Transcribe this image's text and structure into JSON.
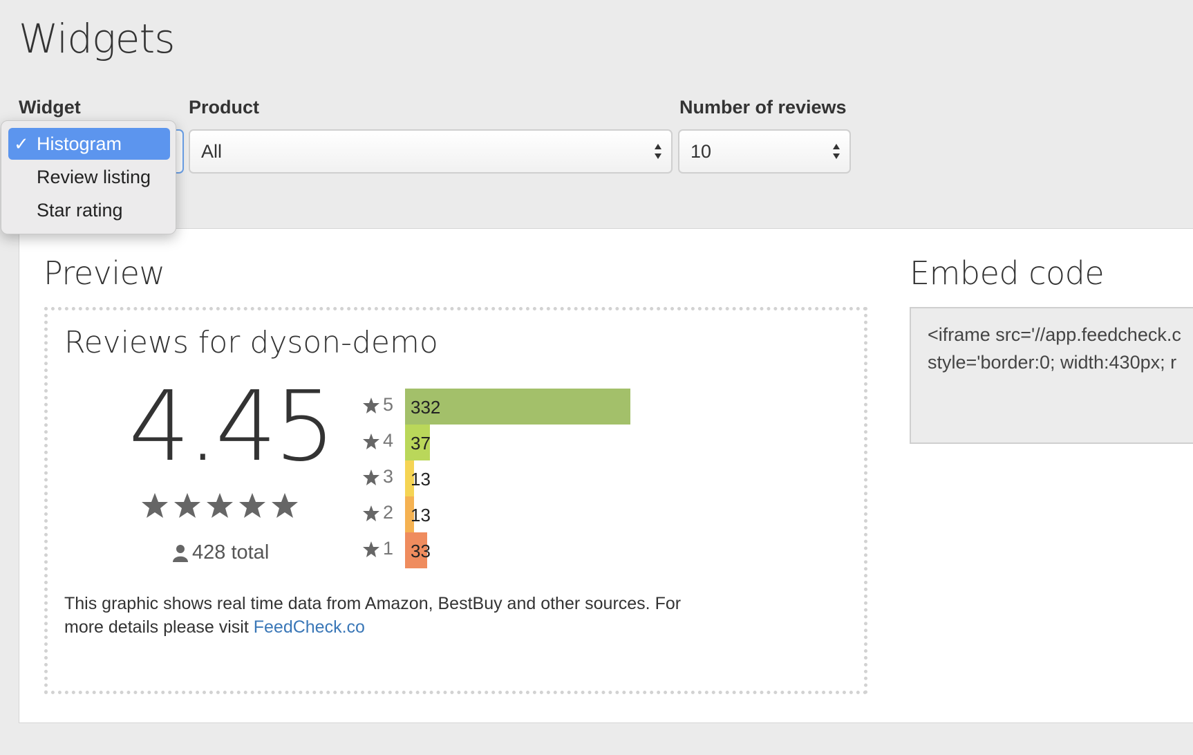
{
  "page": {
    "title": "Widgets"
  },
  "form": {
    "widget_label": "Widget",
    "product_label": "Product",
    "reviews_label": "Number of reviews",
    "product_value": "All",
    "reviews_value": "10",
    "widget_options": [
      {
        "label": "Histogram",
        "selected": true
      },
      {
        "label": "Review listing",
        "selected": false
      },
      {
        "label": "Star rating",
        "selected": false
      }
    ],
    "check_mark": "✓"
  },
  "preview": {
    "section_title": "Preview",
    "widget_title": "Reviews for dyson-demo",
    "average": "4.45",
    "total": "428 total",
    "footnote_text": "This graphic shows real time data from Amazon, BestBuy and other sources. For more details please visit ",
    "footnote_link": "FeedCheck.co"
  },
  "embed": {
    "section_title": "Embed code",
    "line1": "<iframe src='//app.feedcheck.c",
    "line2": "style='border:0; width:430px; r"
  },
  "chart_data": {
    "type": "bar",
    "categories": [
      "5",
      "4",
      "3",
      "2",
      "1"
    ],
    "values": [
      332,
      37,
      13,
      13,
      33
    ],
    "colors": [
      "#a3c06a",
      "#bad75a",
      "#f5d454",
      "#f5b252",
      "#ef8c5e"
    ]
  },
  "colors": {
    "accent": "#5c95ee",
    "link": "#3a77b7",
    "star": "#666666"
  }
}
